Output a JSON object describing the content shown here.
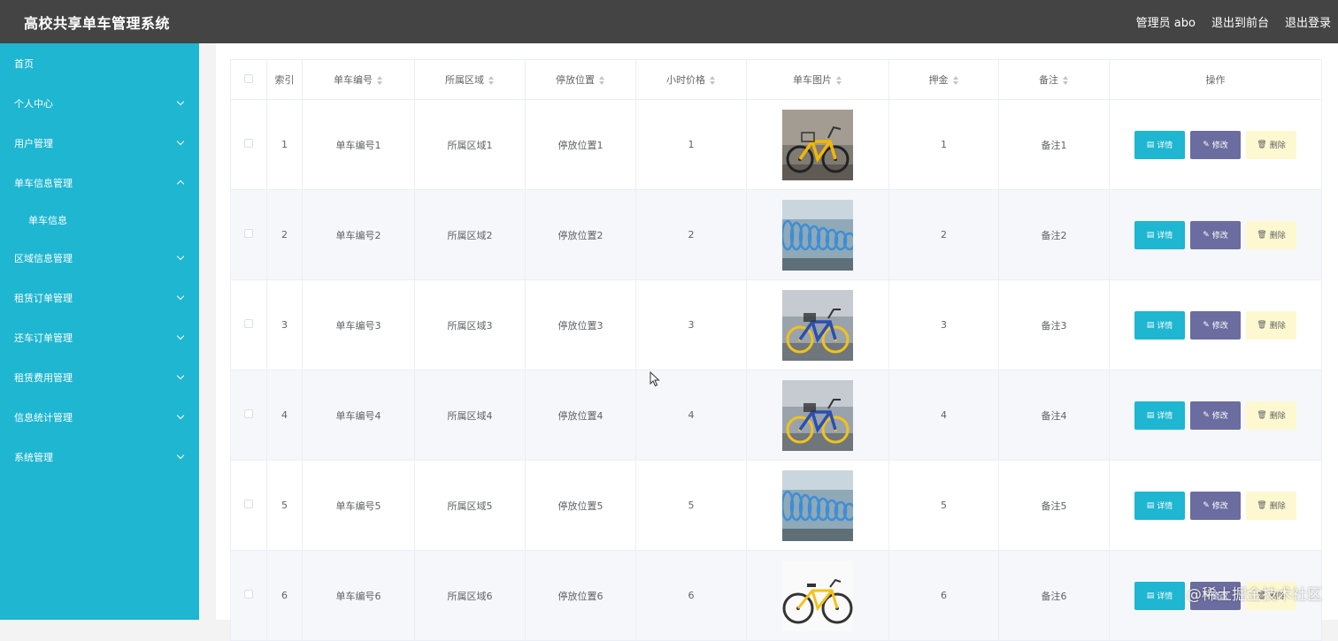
{
  "app": {
    "title": "高校共享单车管理系统"
  },
  "header": {
    "admin_label": "管理员 abo",
    "to_front": "退出到前台",
    "logout": "退出登录"
  },
  "sidebar": {
    "items": [
      {
        "label": "首页",
        "chevron": "none"
      },
      {
        "label": "个人中心",
        "chevron": "down"
      },
      {
        "label": "用户管理",
        "chevron": "down"
      },
      {
        "label": "单车信息管理",
        "chevron": "up"
      },
      {
        "label": "单车信息",
        "chevron": "none",
        "sub": true
      },
      {
        "label": "区域信息管理",
        "chevron": "down"
      },
      {
        "label": "租赁订单管理",
        "chevron": "down"
      },
      {
        "label": "还车订单管理",
        "chevron": "down"
      },
      {
        "label": "租赁费用管理",
        "chevron": "down"
      },
      {
        "label": "信息统计管理",
        "chevron": "down"
      },
      {
        "label": "系统管理",
        "chevron": "down"
      }
    ]
  },
  "table": {
    "headers": [
      "索引",
      "单车编号",
      "所属区域",
      "停放位置",
      "小时价格",
      "单车图片",
      "押金",
      "备注",
      "操作"
    ],
    "rows": [
      {
        "index": "1",
        "code": "单车编号1",
        "area": "所属区域1",
        "location": "停放位置1",
        "price": "1",
        "image": "yellow-bike-photo",
        "deposit": "1",
        "note": "备注1"
      },
      {
        "index": "2",
        "code": "单车编号2",
        "area": "所属区域2",
        "location": "停放位置2",
        "price": "2",
        "image": "bike-rows-photo",
        "deposit": "2",
        "note": "备注2"
      },
      {
        "index": "3",
        "code": "单车编号3",
        "area": "所属区域3",
        "location": "停放位置3",
        "price": "3",
        "image": "blue-yellow-bike-photo",
        "deposit": "3",
        "note": "备注3"
      },
      {
        "index": "4",
        "code": "单车编号4",
        "area": "所属区域4",
        "location": "停放位置4",
        "price": "4",
        "image": "blue-yellow-bike-photo",
        "deposit": "4",
        "note": "备注4"
      },
      {
        "index": "5",
        "code": "单车编号5",
        "area": "所属区域5",
        "location": "停放位置5",
        "price": "5",
        "image": "bike-rows-photo",
        "deposit": "5",
        "note": "备注5"
      },
      {
        "index": "6",
        "code": "单车编号6",
        "area": "所属区域6",
        "location": "停放位置6",
        "price": "6",
        "image": "white-yellow-bike-photo",
        "deposit": "6",
        "note": "备注6"
      }
    ],
    "actions": {
      "detail": "详情",
      "edit": "修改",
      "delete": "删除"
    }
  },
  "watermark": "@稀土掘金技术社区",
  "colors": {
    "topbar": "#444444",
    "sidebar": "#1eb6d1",
    "detail_btn": "#1eb6d1",
    "edit_btn": "#6b6c9f",
    "delete_btn": "#fdf8d0"
  }
}
